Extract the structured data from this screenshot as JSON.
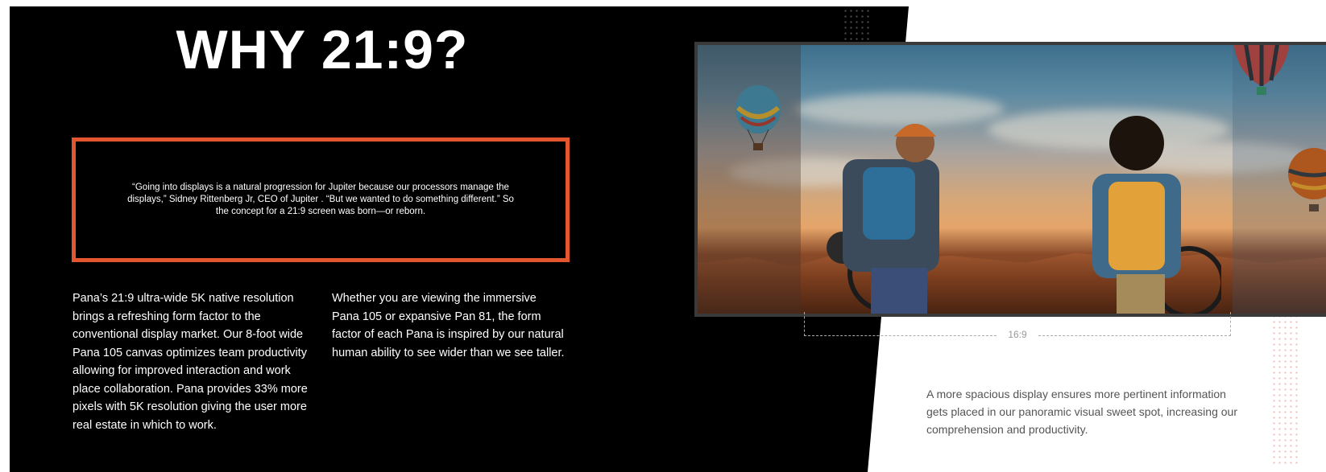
{
  "heading": "WHY 21:9?",
  "quote": "“Going into displays is a natural progression for Jupiter because our processors manage the displays,” Sidney Rittenberg Jr, CEO of Jupiter . “But we wanted to do something different.” So the concept for a 21:9 screen was born—or reborn.",
  "body_left": "Pana’s 21:9 ultra-wide 5K native resolution brings a refreshing form factor to the conventional display market. Our 8-foot wide Pana 105 canvas optimizes team productivity allowing for improved interaction and work place collaboration. Pana provides 33% more pixels with 5K resolution giving the user more real estate in which to work.",
  "body_right": "Whether you are viewing the immersive Pana 105 or expansive Pan 81, the form factor of each Pana is inspired by our natural human ability to see wider than we see taller.",
  "aspect_label": "16:9",
  "caption": "A more spacious display ensures more pertinent information gets placed in our panoramic visual sweet spot, increasing our comprehension and productivity.",
  "colors": {
    "accent": "#e4572e",
    "dark_background": "#000000",
    "light_background": "#ffffff"
  }
}
